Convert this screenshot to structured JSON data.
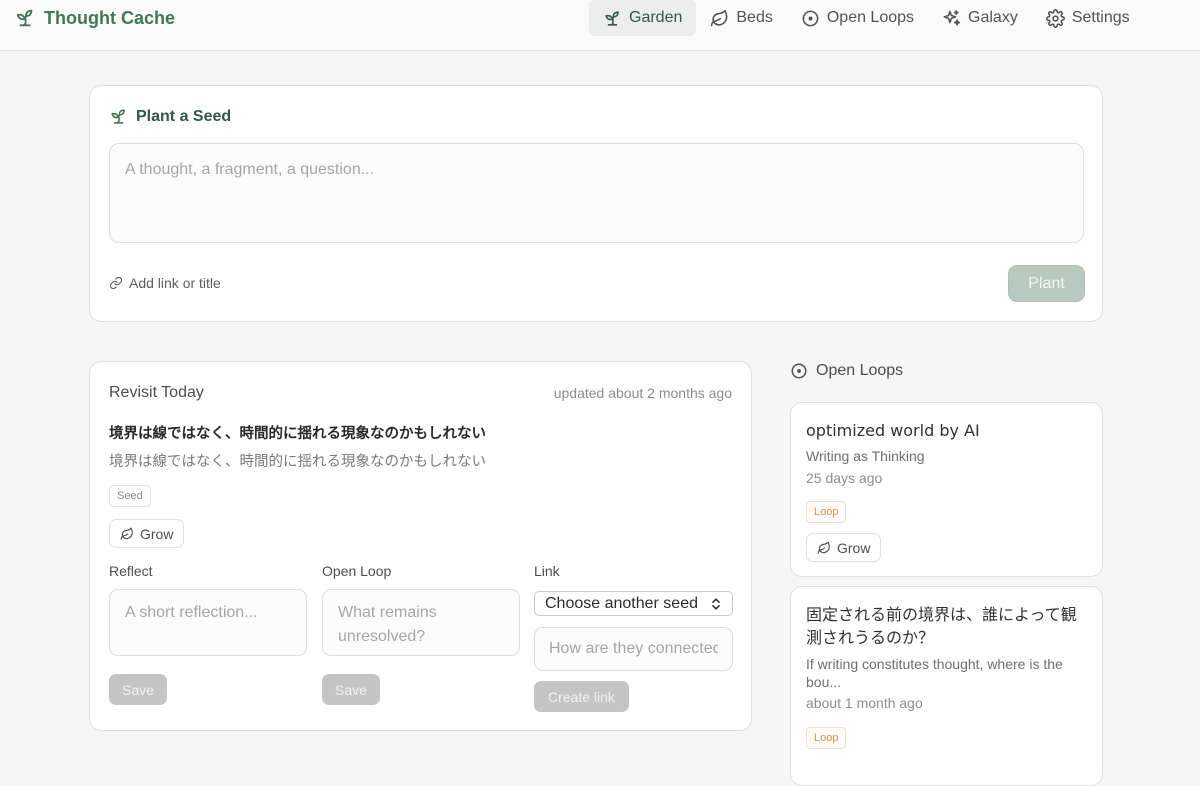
{
  "app": {
    "name": "Thought Cache"
  },
  "nav": [
    {
      "label": "Garden",
      "icon": "sprout-icon",
      "active": true
    },
    {
      "label": "Beds",
      "icon": "leaf-icon",
      "active": false
    },
    {
      "label": "Open Loops",
      "icon": "circle-dot-icon",
      "active": false
    },
    {
      "label": "Galaxy",
      "icon": "sparkles-icon",
      "active": false
    },
    {
      "label": "Settings",
      "icon": "gear-icon",
      "active": false
    }
  ],
  "plant_seed": {
    "title": "Plant a Seed",
    "placeholder": "A thought, a fragment, a question...",
    "add_link_label": "Add link or title",
    "plant_label": "Plant"
  },
  "revisit": {
    "title": "Revisit Today",
    "updated": "updated about 2 months ago",
    "heading": "境界は線ではなく、時間的に揺れる現象なのかもしれない",
    "body": "境界は線ではなく、時間的に揺れる現象なのかもしれない",
    "tag": "Seed",
    "grow_label": "Grow",
    "reflect": {
      "label": "Reflect",
      "placeholder": "A short reflection...",
      "save_label": "Save"
    },
    "open_loop": {
      "label": "Open Loop",
      "placeholder": "What remains unresolved?",
      "save_label": "Save"
    },
    "link": {
      "label": "Link",
      "select_value": "Choose another seed",
      "placeholder": "How are they connected?",
      "create_label": "Create link"
    }
  },
  "open_loops": {
    "title": "Open Loops",
    "items": [
      {
        "title": "optimized world by AI",
        "subtitle": "Writing as Thinking",
        "time": "25 days ago",
        "tag": "Loop",
        "grow_label": "Grow"
      },
      {
        "title": "固定される前の境界は、誰によって観測されうるのか？",
        "subtitle": "If writing constitutes thought, where is the bou...",
        "time": "about 1 month ago",
        "tag": "Loop"
      }
    ]
  },
  "colors": {
    "brand": "#3d7a55",
    "accent_bg": "#eceeeb",
    "loop_tag": "#e0923a",
    "disabled_button": "#c3c6c3"
  }
}
